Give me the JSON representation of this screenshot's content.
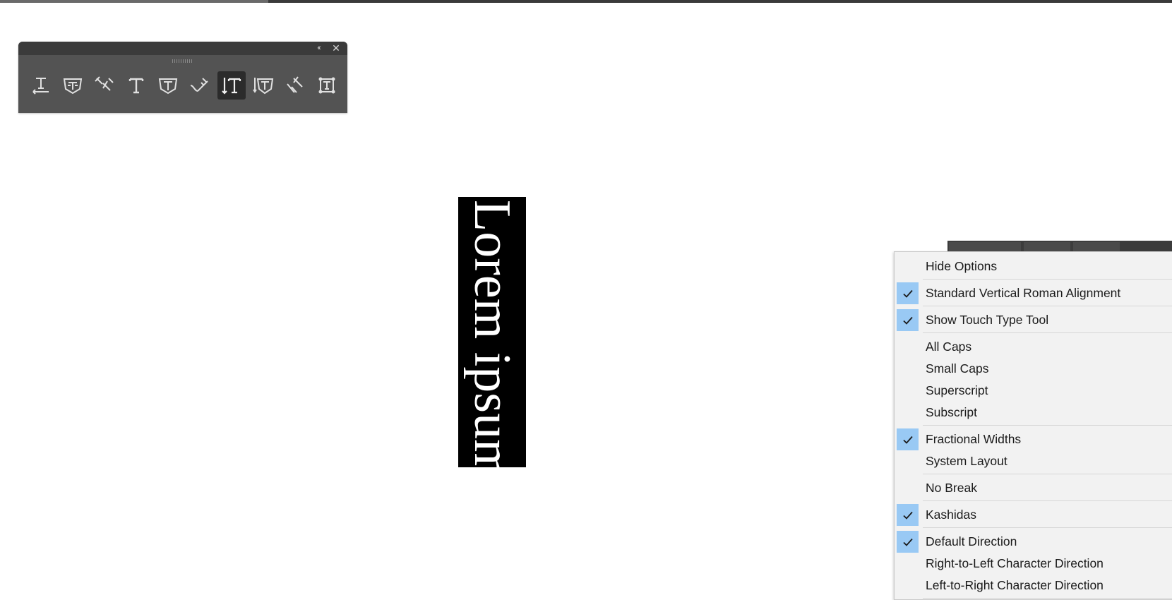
{
  "toolbar": {
    "collapse_glyph": "‹‹",
    "close_glyph": "✕",
    "tools": [
      {
        "icon": "type-on-path-icon"
      },
      {
        "icon": "area-type-icon"
      },
      {
        "icon": "type-path-reverse-icon"
      },
      {
        "icon": "type-tool-icon"
      },
      {
        "icon": "area-type-alt-icon"
      },
      {
        "icon": "path-type-icon"
      },
      {
        "icon": "vertical-type-tool-icon",
        "selected": true
      },
      {
        "icon": "vertical-area-type-icon"
      },
      {
        "icon": "vertical-path-type-icon"
      },
      {
        "icon": "touch-type-tool-icon"
      }
    ]
  },
  "canvas": {
    "text": "Lorem ipsum",
    "box_color": "#000000",
    "text_color": "#ffffff"
  },
  "menu": {
    "check_color": "#99c9f4",
    "items": [
      {
        "label": "Hide Options",
        "checked": false
      },
      {
        "label": "Standard Vertical Roman Alignment",
        "checked": true
      },
      {
        "label": "Show Touch Type Tool",
        "checked": true
      },
      {
        "label": "All Caps",
        "checked": false
      },
      {
        "label": "Small Caps",
        "checked": false
      },
      {
        "label": "Superscript",
        "checked": false
      },
      {
        "label": "Subscript",
        "checked": false
      },
      {
        "label": "Fractional Widths",
        "checked": true
      },
      {
        "label": "System Layout",
        "checked": false
      },
      {
        "label": "No Break",
        "checked": false
      },
      {
        "label": "Kashidas",
        "checked": true
      },
      {
        "label": "Default Direction",
        "checked": true
      },
      {
        "label": "Right-to-Left Character Direction",
        "checked": false
      },
      {
        "label": "Left-to-Right Character Direction",
        "checked": false
      }
    ]
  }
}
